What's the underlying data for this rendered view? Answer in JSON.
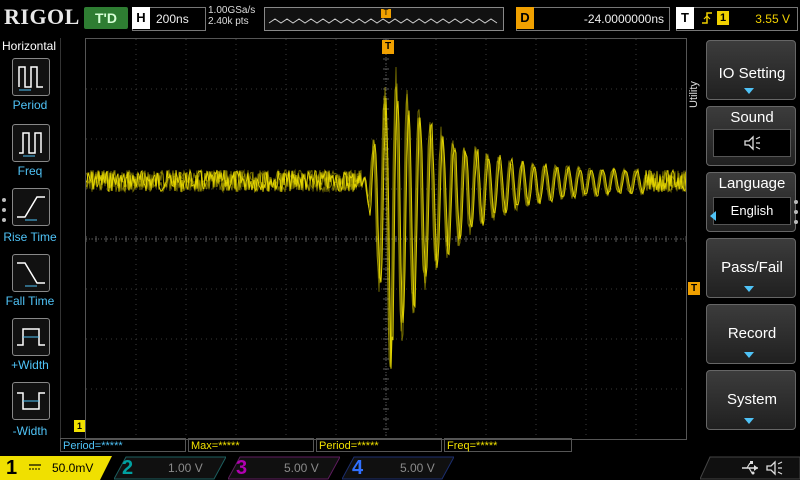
{
  "topbar": {
    "logo": "RIGOL",
    "run_state": "T'D",
    "horizontal": {
      "label": "H",
      "value": "200ns"
    },
    "sample_rate": "1.00GSa/s",
    "memory_depth": "2.40k pts",
    "trigger_marker": "T",
    "delay": {
      "label": "D",
      "value": "-24.0000000ns"
    },
    "trigger": {
      "label": "T",
      "edge": "rising-edge-icon",
      "source": "1",
      "level": "3.55 V"
    }
  },
  "left_menu": {
    "title": "Horizontal",
    "items": [
      {
        "label": "Period",
        "icon": "period-icon"
      },
      {
        "label": "Freq",
        "icon": "frequency-icon"
      },
      {
        "label": "Rise Time",
        "icon": "rise-time-icon"
      },
      {
        "label": "Fall Time",
        "icon": "fall-time-icon"
      },
      {
        "label": "+Width",
        "icon": "positive-width-icon"
      },
      {
        "label": "-Width",
        "icon": "negative-width-icon"
      }
    ]
  },
  "measurements": [
    {
      "label": "Period=*****",
      "color": "#4fc3f7"
    },
    {
      "label": "Max=*****",
      "color": "#f0e000"
    },
    {
      "label": "Period=*****",
      "color": "#f0e000"
    },
    {
      "label": "Freq=*****",
      "color": "#f0e000"
    }
  ],
  "channels": [
    {
      "num": "1",
      "scale": "50.0mV",
      "color": "#f0e000",
      "active": true
    },
    {
      "num": "2",
      "scale": "1.00 V",
      "color": "#00b0b0",
      "active": false
    },
    {
      "num": "3",
      "scale": "5.00 V",
      "color": "#c000c0",
      "active": false
    },
    {
      "num": "4",
      "scale": "5.00 V",
      "color": "#3070ff",
      "active": false
    }
  ],
  "right_menu": {
    "title": "Utility",
    "items": [
      {
        "label": "IO Setting"
      },
      {
        "label": "Sound",
        "sub_icon": "speaker-icon"
      },
      {
        "label": "Language",
        "sub_value": "English"
      },
      {
        "label": "Pass/Fail"
      },
      {
        "label": "Record"
      },
      {
        "label": "System"
      }
    ]
  },
  "markers": {
    "trigger_position": "T",
    "trigger_level": "T",
    "channel_ground": "1"
  },
  "status_icons": [
    "usb-icon",
    "speaker-icon"
  ],
  "colors": {
    "ch1": "#f0e000",
    "accent": "#4fc3f7",
    "trigger": "#f0a000"
  }
}
